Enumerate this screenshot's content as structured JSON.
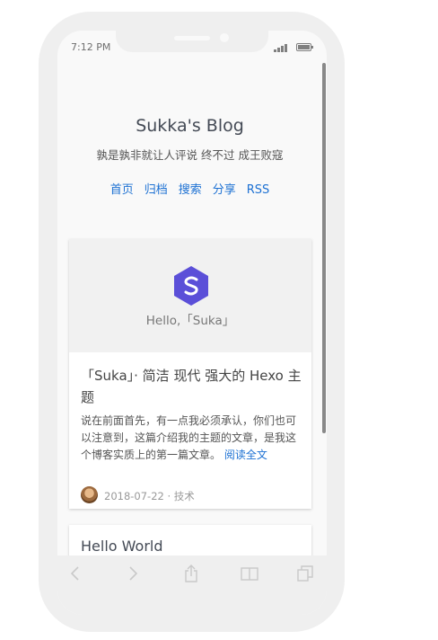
{
  "status": {
    "time": "7:12 PM"
  },
  "blog": {
    "title": "Sukka's Blog",
    "subtitle": "孰是孰非就让人评说 终不过 成王败寇",
    "nav": [
      "首页",
      "归档",
      "搜索",
      "分享",
      "RSS"
    ]
  },
  "posts": [
    {
      "banner_caption": "Hello,「Suka」",
      "title": "「Suka」· 简洁 现代 强大的 Hexo 主题",
      "excerpt": "说在前面首先，有一点我必须承认，你们也可以注意到，这篇介绍我的主题的文章，是我这个博客实质上的第一篇文章。",
      "read_more": "阅读全文",
      "meta": "2018-07-22 · 技术"
    },
    {
      "title": "Hello World"
    }
  ],
  "colors": {
    "accent": "#1d71d3",
    "logo": "#5b4fd8"
  },
  "toolbar_icons": [
    "back-icon",
    "forward-icon",
    "share-icon",
    "bookmarks-icon",
    "tabs-icon"
  ]
}
